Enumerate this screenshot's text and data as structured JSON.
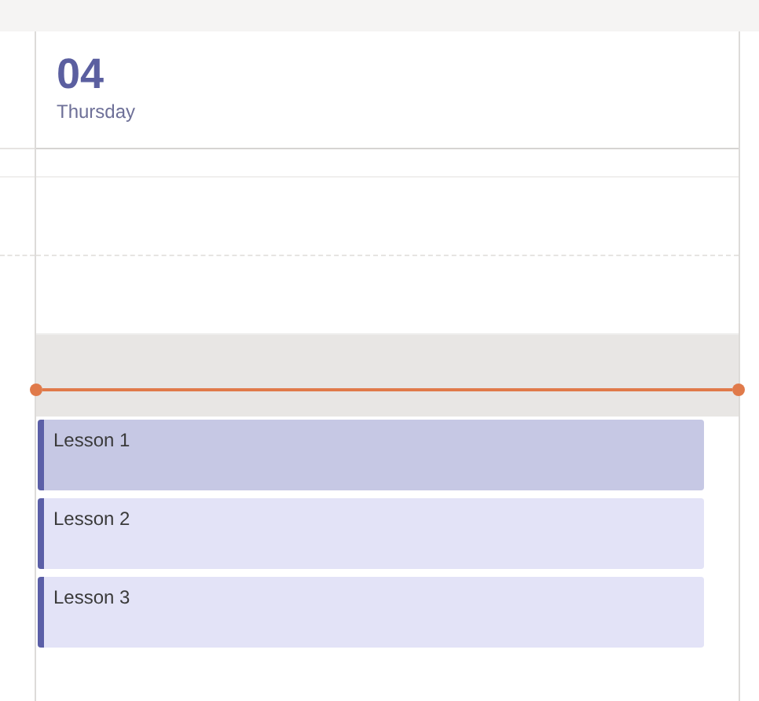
{
  "day": {
    "number": "04",
    "weekday": "Thursday"
  },
  "events": [
    {
      "title": "Lesson 1",
      "selected": true
    },
    {
      "title": "Lesson 2",
      "selected": false
    },
    {
      "title": "Lesson 3",
      "selected": false
    }
  ]
}
